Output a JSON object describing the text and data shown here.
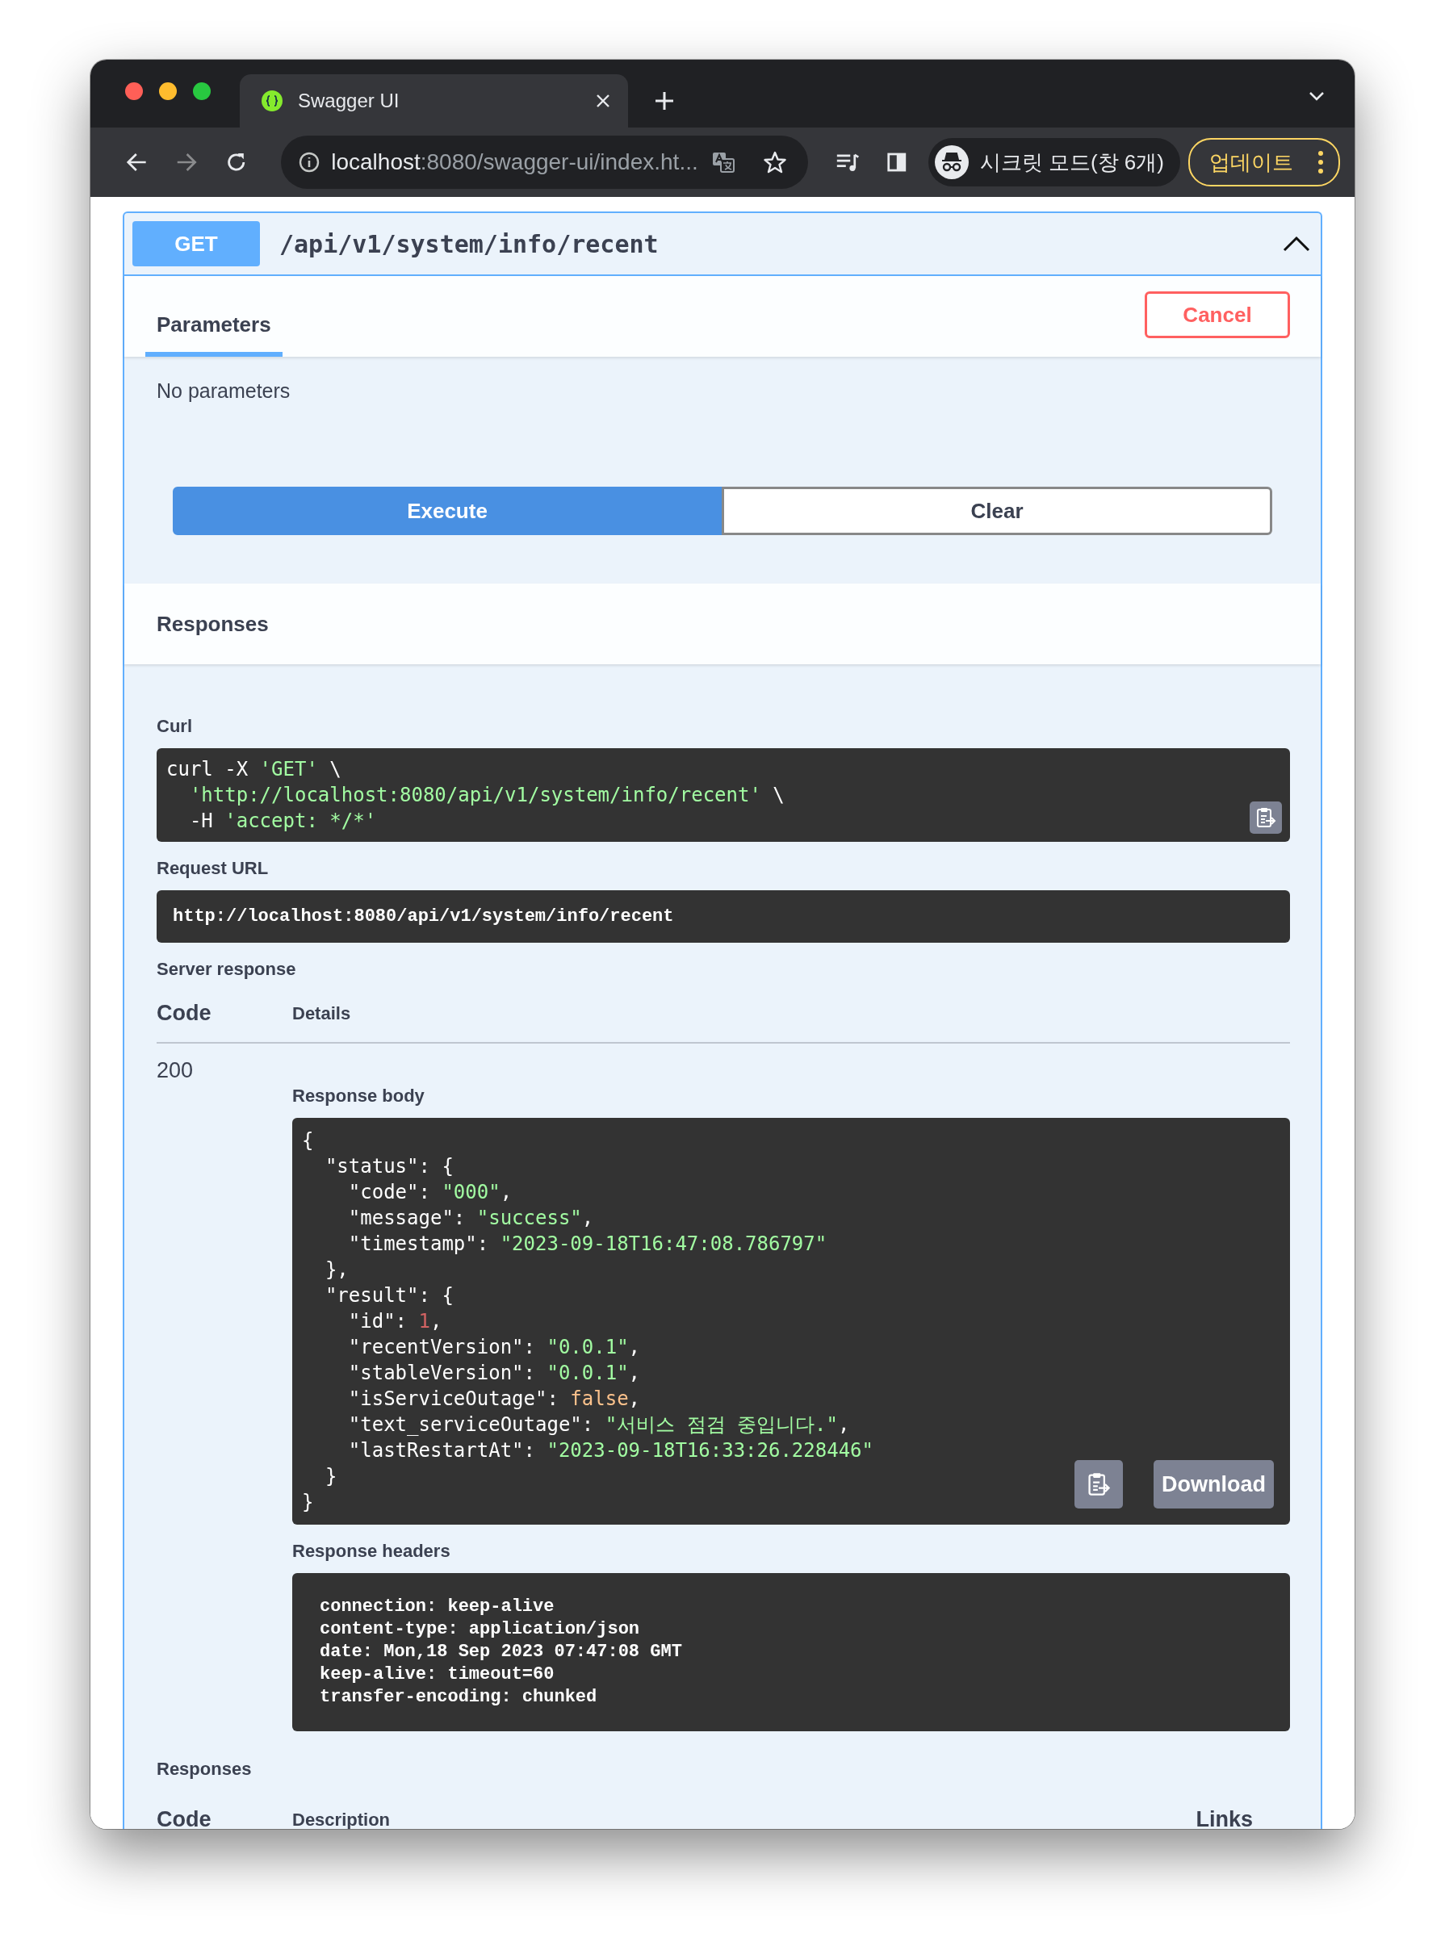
{
  "browser": {
    "tab": {
      "title": "Swagger UI",
      "selected": true
    },
    "address": {
      "host": "localhost",
      "path": ":8080/swagger-ui/index.ht..."
    },
    "incognito": "시크릿 모드(창 6개)",
    "update": "업데이트"
  },
  "operation": {
    "method": "GET",
    "path": "/api/v1/system/info/recent",
    "expanded": true
  },
  "parameters": {
    "tab": {
      "label": "Parameters",
      "selected": true
    },
    "cancel": "Cancel",
    "empty": "No parameters",
    "execute": "Execute",
    "clear": "Clear"
  },
  "responses_title": "Responses",
  "curl": {
    "label": "Curl",
    "lines": [
      [
        {
          "kind": "plain",
          "text": "curl -X "
        },
        {
          "kind": "string",
          "text": "'GET'"
        },
        {
          "kind": "plain",
          "text": " \\"
        }
      ],
      [
        {
          "kind": "string",
          "text": "  'http://localhost:8080/api/v1/system/info/recent'"
        },
        {
          "kind": "plain",
          "text": " \\"
        }
      ],
      [
        {
          "kind": "plain",
          "text": "  -H "
        },
        {
          "kind": "string",
          "text": "'accept: */*'"
        }
      ]
    ]
  },
  "request_url": {
    "label": "Request URL",
    "value": "http://localhost:8080/api/v1/system/info/recent"
  },
  "server_response": {
    "label": "Server response",
    "columns": [
      "Code",
      "Details"
    ],
    "code": "200",
    "body_label": "Response body",
    "body": [
      [
        {
          "kind": "plain",
          "text": "{"
        }
      ],
      [
        {
          "kind": "plain",
          "text": "  \"status\": {"
        }
      ],
      [
        {
          "kind": "plain",
          "text": "    \"code\": "
        },
        {
          "kind": "string",
          "text": "\"000\""
        },
        {
          "kind": "plain",
          "text": ","
        }
      ],
      [
        {
          "kind": "plain",
          "text": "    \"message\": "
        },
        {
          "kind": "string",
          "text": "\"success\""
        },
        {
          "kind": "plain",
          "text": ","
        }
      ],
      [
        {
          "kind": "plain",
          "text": "    \"timestamp\": "
        },
        {
          "kind": "string",
          "text": "\"2023-09-18T16:47:08.786797\""
        }
      ],
      [
        {
          "kind": "plain",
          "text": "  },"
        }
      ],
      [
        {
          "kind": "plain",
          "text": "  \"result\": {"
        }
      ],
      [
        {
          "kind": "plain",
          "text": "    \"id\": "
        },
        {
          "kind": "number",
          "text": "1"
        },
        {
          "kind": "plain",
          "text": ","
        }
      ],
      [
        {
          "kind": "plain",
          "text": "    \"recentVersion\": "
        },
        {
          "kind": "string",
          "text": "\"0.0.1\""
        },
        {
          "kind": "plain",
          "text": ","
        }
      ],
      [
        {
          "kind": "plain",
          "text": "    \"stableVersion\": "
        },
        {
          "kind": "string",
          "text": "\"0.0.1\""
        },
        {
          "kind": "plain",
          "text": ","
        }
      ],
      [
        {
          "kind": "plain",
          "text": "    \"isServiceOutage\": "
        },
        {
          "kind": "boolean",
          "text": "false"
        },
        {
          "kind": "plain",
          "text": ","
        }
      ],
      [
        {
          "kind": "plain",
          "text": "    \"text_serviceOutage\": "
        },
        {
          "kind": "string",
          "text": "\"서비스 점검 중입니다.\""
        },
        {
          "kind": "plain",
          "text": ","
        }
      ],
      [
        {
          "kind": "plain",
          "text": "    \"lastRestartAt\": "
        },
        {
          "kind": "string",
          "text": "\"2023-09-18T16:33:26.228446\""
        }
      ],
      [
        {
          "kind": "plain",
          "text": "  }"
        }
      ],
      [
        {
          "kind": "plain",
          "text": "}"
        }
      ]
    ],
    "download": "Download",
    "headers_label": "Response headers",
    "headers": [
      "connection: keep-alive",
      "content-type: application/json",
      "date: Mon,18 Sep 2023 07:47:08 GMT",
      "keep-alive: timeout=60",
      "transfer-encoding: chunked"
    ]
  },
  "responses": {
    "label": "Responses",
    "columns": [
      "Code",
      "Description",
      "Links"
    ]
  }
}
